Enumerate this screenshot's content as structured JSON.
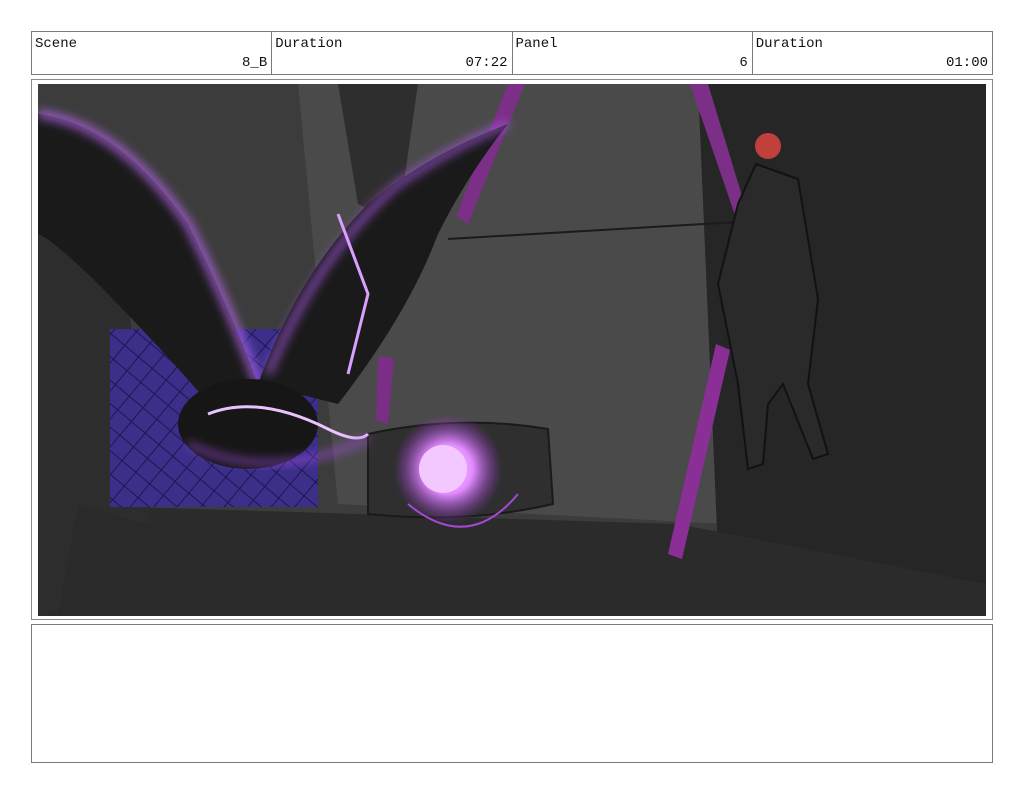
{
  "header": {
    "scene_label": "Scene",
    "scene_value": "8_B",
    "duration_label": "Duration",
    "duration_value": "07:22",
    "panel_label": "Panel",
    "panel_value": "6",
    "panel_duration_label": "Duration",
    "panel_duration_value": "01:00"
  },
  "notes": {
    "text": ""
  }
}
